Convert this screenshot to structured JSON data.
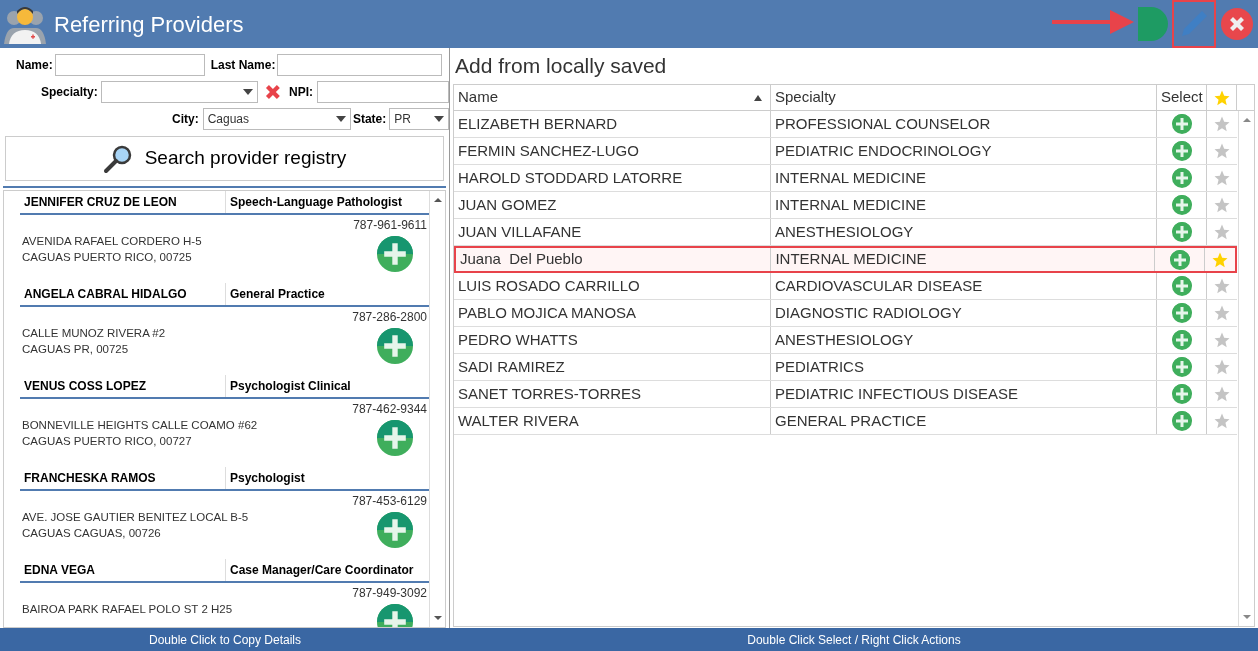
{
  "window": {
    "title": "Referring Providers"
  },
  "search_form": {
    "name_label": "Name:",
    "last_name_label": "Last Name:",
    "specialty_label": "Specialty:",
    "npi_label": "NPI:",
    "city_label": "City:",
    "city_value": "Caguas",
    "state_label": "State:",
    "state_value": "PR",
    "search_button": "Search provider registry"
  },
  "registry_results": [
    {
      "name": "JENNIFER CRUZ DE LEON",
      "specialty": "Speech-Language Pathologist",
      "phone": "787-961-9611",
      "address": [
        "AVENIDA RAFAEL CORDERO H-5",
        "CAGUAS PUERTO RICO, 00725"
      ]
    },
    {
      "name": "ANGELA CABRAL HIDALGO",
      "specialty": "General Practice",
      "phone": "787-286-2800",
      "address": [
        "CALLE MUNOZ RIVERA #2",
        "CAGUAS PR, 00725"
      ]
    },
    {
      "name": "VENUS COSS LOPEZ",
      "specialty": "Psychologist Clinical",
      "phone": "787-462-9344",
      "address": [
        "BONNEVILLE HEIGHTS CALLE COAMO #62",
        "CAGUAS PUERTO RICO, 00727"
      ]
    },
    {
      "name": "FRANCHESKA RAMOS",
      "specialty": "Psychologist",
      "phone": "787-453-6129",
      "address": [
        "AVE. JOSE GAUTIER BENITEZ LOCAL B-5",
        "CAGUAS CAGUAS, 00726"
      ]
    },
    {
      "name": "EDNA VEGA",
      "specialty": "Case Manager/Care Coordinator",
      "phone": "787-949-3092",
      "address": [
        "BAIROA PARK RAFAEL POLO ST 2 H25"
      ]
    }
  ],
  "local_panel": {
    "title": "Add from locally saved",
    "columns": [
      "Name",
      "Specialty",
      "Select"
    ]
  },
  "rows": [
    {
      "name": "ELIZABETH BERNARD",
      "specialty": "PROFESSIONAL COUNSELOR",
      "starred": false,
      "selected": false
    },
    {
      "name": "FERMIN SANCHEZ-LUGO",
      "specialty": "PEDIATRIC ENDOCRINOLOGY",
      "starred": false,
      "selected": false
    },
    {
      "name": "HAROLD STODDARD LATORRE",
      "specialty": "INTERNAL MEDICINE",
      "starred": false,
      "selected": false
    },
    {
      "name": "JUAN GOMEZ",
      "specialty": "INTERNAL MEDICINE",
      "starred": false,
      "selected": false
    },
    {
      "name": "JUAN VILLAFANE",
      "specialty": "ANESTHESIOLOGY",
      "starred": false,
      "selected": false
    },
    {
      "name": "Juana  Del Pueblo",
      "specialty": "INTERNAL MEDICINE",
      "starred": true,
      "selected": true
    },
    {
      "name": "LUIS ROSADO CARRILLO",
      "specialty": "CARDIOVASCULAR DISEASE",
      "starred": false,
      "selected": false
    },
    {
      "name": "PABLO MOJICA MANOSA",
      "specialty": "DIAGNOSTIC RADIOLOGY",
      "starred": false,
      "selected": false
    },
    {
      "name": "PEDRO WHATTS",
      "specialty": "ANESTHESIOLOGY",
      "starred": false,
      "selected": false
    },
    {
      "name": "SADI RAMIREZ",
      "specialty": "PEDIATRICS",
      "starred": false,
      "selected": false
    },
    {
      "name": "SANET TORRES-TORRES",
      "specialty": "PEDIATRIC INFECTIOUS DISEASE",
      "starred": false,
      "selected": false
    },
    {
      "name": "WALTER RIVERA",
      "specialty": "GENERAL PRACTICE",
      "starred": false,
      "selected": false
    }
  ],
  "status_bar": {
    "left": "Double Click to Copy Details",
    "right": "Double Click Select / Right Click Actions"
  }
}
